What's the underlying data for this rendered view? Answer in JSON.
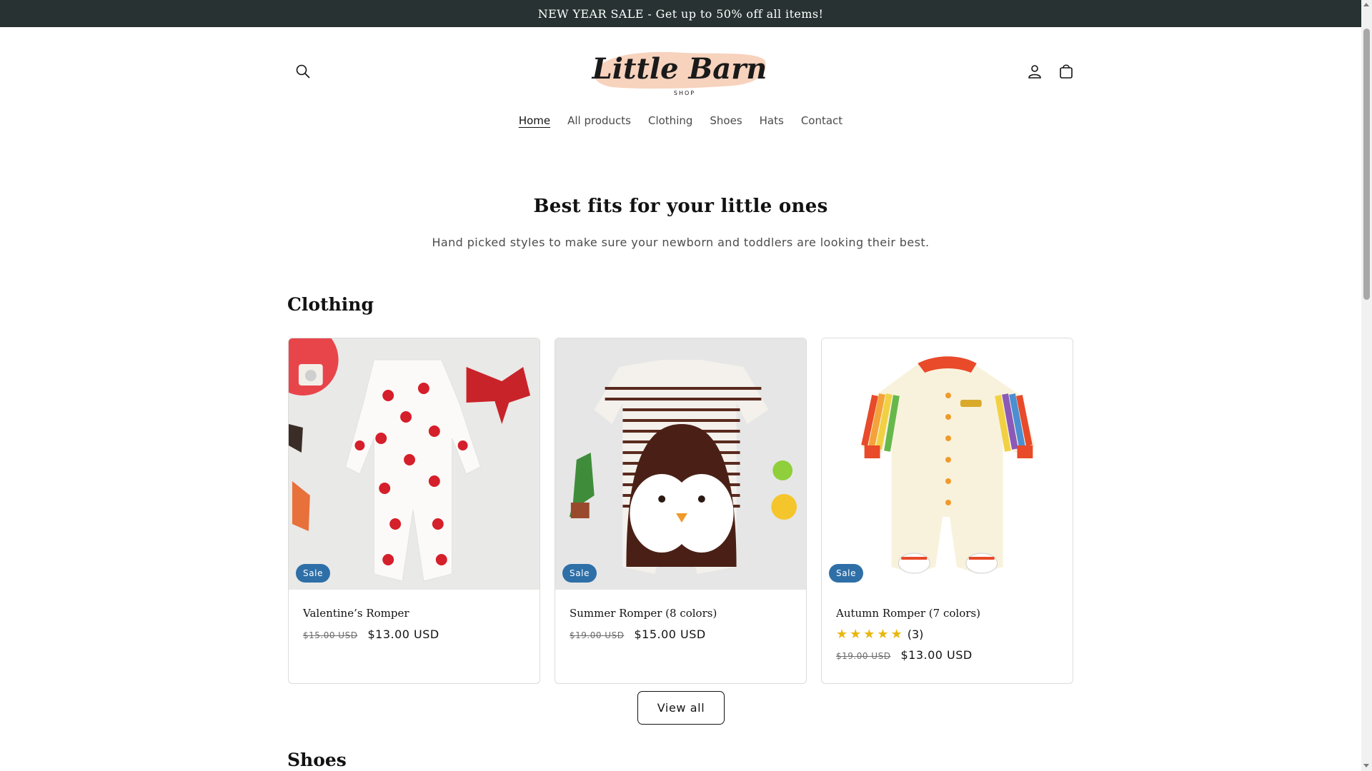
{
  "announcement": {
    "text": "NEW YEAR SALE - Get up to 50% off all items!"
  },
  "header": {
    "logo_text": "Little Barn",
    "logo_sub": "SHOP",
    "icons": [
      "search-icon",
      "account-icon",
      "cart-icon"
    ]
  },
  "nav": {
    "items": [
      {
        "label": "Home",
        "active": true
      },
      {
        "label": "All products"
      },
      {
        "label": "Clothing"
      },
      {
        "label": "Shoes"
      },
      {
        "label": "Hats"
      },
      {
        "label": "Contact"
      }
    ]
  },
  "hero": {
    "title": "Best fits for your little ones",
    "subtitle": "Hand picked styles to make sure your newborn and toddlers are looking their best."
  },
  "sections": {
    "clothing": {
      "heading": "Clothing",
      "view_all": "View all"
    },
    "shoes": {
      "heading": "Shoes"
    }
  },
  "products": [
    {
      "title": "Valentine’s Romper",
      "badge": "Sale",
      "price_old": "$15.00 USD",
      "price_new": "$13.00 USD"
    },
    {
      "title": "Summer Romper (8 colors)",
      "badge": "Sale",
      "price_old": "$19.00 USD",
      "price_new": "$15.00 USD"
    },
    {
      "title": "Autumn Romper (7 colors)",
      "badge": "Sale",
      "rating_count": "(3)",
      "rating_stars": 5,
      "price_old": "$19.00 USD",
      "price_new": "$13.00 USD"
    }
  ],
  "colors": {
    "announcement_bg": "#283232",
    "sale_badge": "#2e6fa8",
    "star": "#e8b70e"
  }
}
